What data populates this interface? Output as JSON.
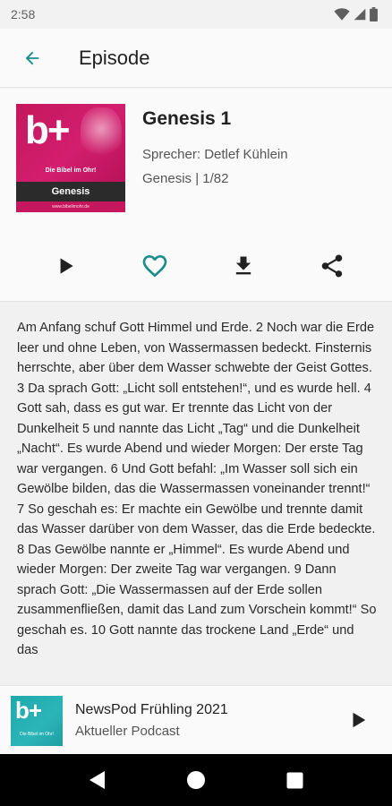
{
  "status_bar": {
    "time": "2:58",
    "icons": [
      "wifi-icon",
      "signal-icon",
      "battery-icon"
    ]
  },
  "app_bar": {
    "title": "Episode",
    "back_icon": "arrow-back-icon"
  },
  "episode": {
    "title": "Genesis 1",
    "speaker": "Sprecher: Detlef Kühlein",
    "meta": "Genesis | 1/82",
    "cover": {
      "logo": "b+",
      "subtitle": "Die Bibel im Ohr!",
      "band": "Genesis",
      "footer": "www.bibelimohr.de"
    }
  },
  "actions": [
    {
      "name": "play-button",
      "icon": "play-icon"
    },
    {
      "name": "favorite-button",
      "icon": "heart-outline-icon"
    },
    {
      "name": "download-button",
      "icon": "download-icon"
    },
    {
      "name": "share-button",
      "icon": "share-icon"
    }
  ],
  "content": {
    "text": "Am Anfang schuf Gott Himmel und Erde. 2 Noch war die Erde leer und ohne Leben, von Wassermassen bedeckt. Finsternis herrschte, aber über dem Wasser schwebte der Geist Gottes. 3 Da sprach Gott: „Licht soll entstehen!“, und es wurde hell. 4 Gott sah, dass es gut war. Er trennte das Licht von der Dunkelheit 5 und nannte das Licht „Tag“ und die Dunkelheit „Nacht“. Es wurde Abend und wieder Morgen: Der erste Tag war vergangen. 6 Und Gott befahl: „Im Wasser soll sich ein Gewölbe bilden, das die Wassermassen voneinander trennt!“ 7 So geschah es: Er machte ein Gewölbe und trennte damit das Wasser darüber von dem Wasser, das die Erde bedeckte. 8 Das Gewölbe nannte er „Himmel“. Es wurde Abend und wieder Morgen: Der zweite Tag war vergangen. 9 Dann sprach Gott: „Die Wassermassen auf der Erde sollen zusammenfließen, damit das Land zum Vorschein kommt!“ So geschah es. 10 Gott nannte das trockene Land „Erde“ und das"
  },
  "mini_player": {
    "title": "NewsPod Frühling 2021",
    "subtitle": "Aktueller Podcast",
    "cover": {
      "logo": "b+",
      "subtitle": "Die Bibel im Ohr!"
    }
  },
  "nav_bar": {
    "buttons": [
      "back-triangle-icon",
      "home-circle-icon",
      "recents-square-icon"
    ]
  },
  "colors": {
    "accent": "#1a8c8c",
    "cover_pink": "#c4175d",
    "cover_teal": "#2bb5b8"
  }
}
